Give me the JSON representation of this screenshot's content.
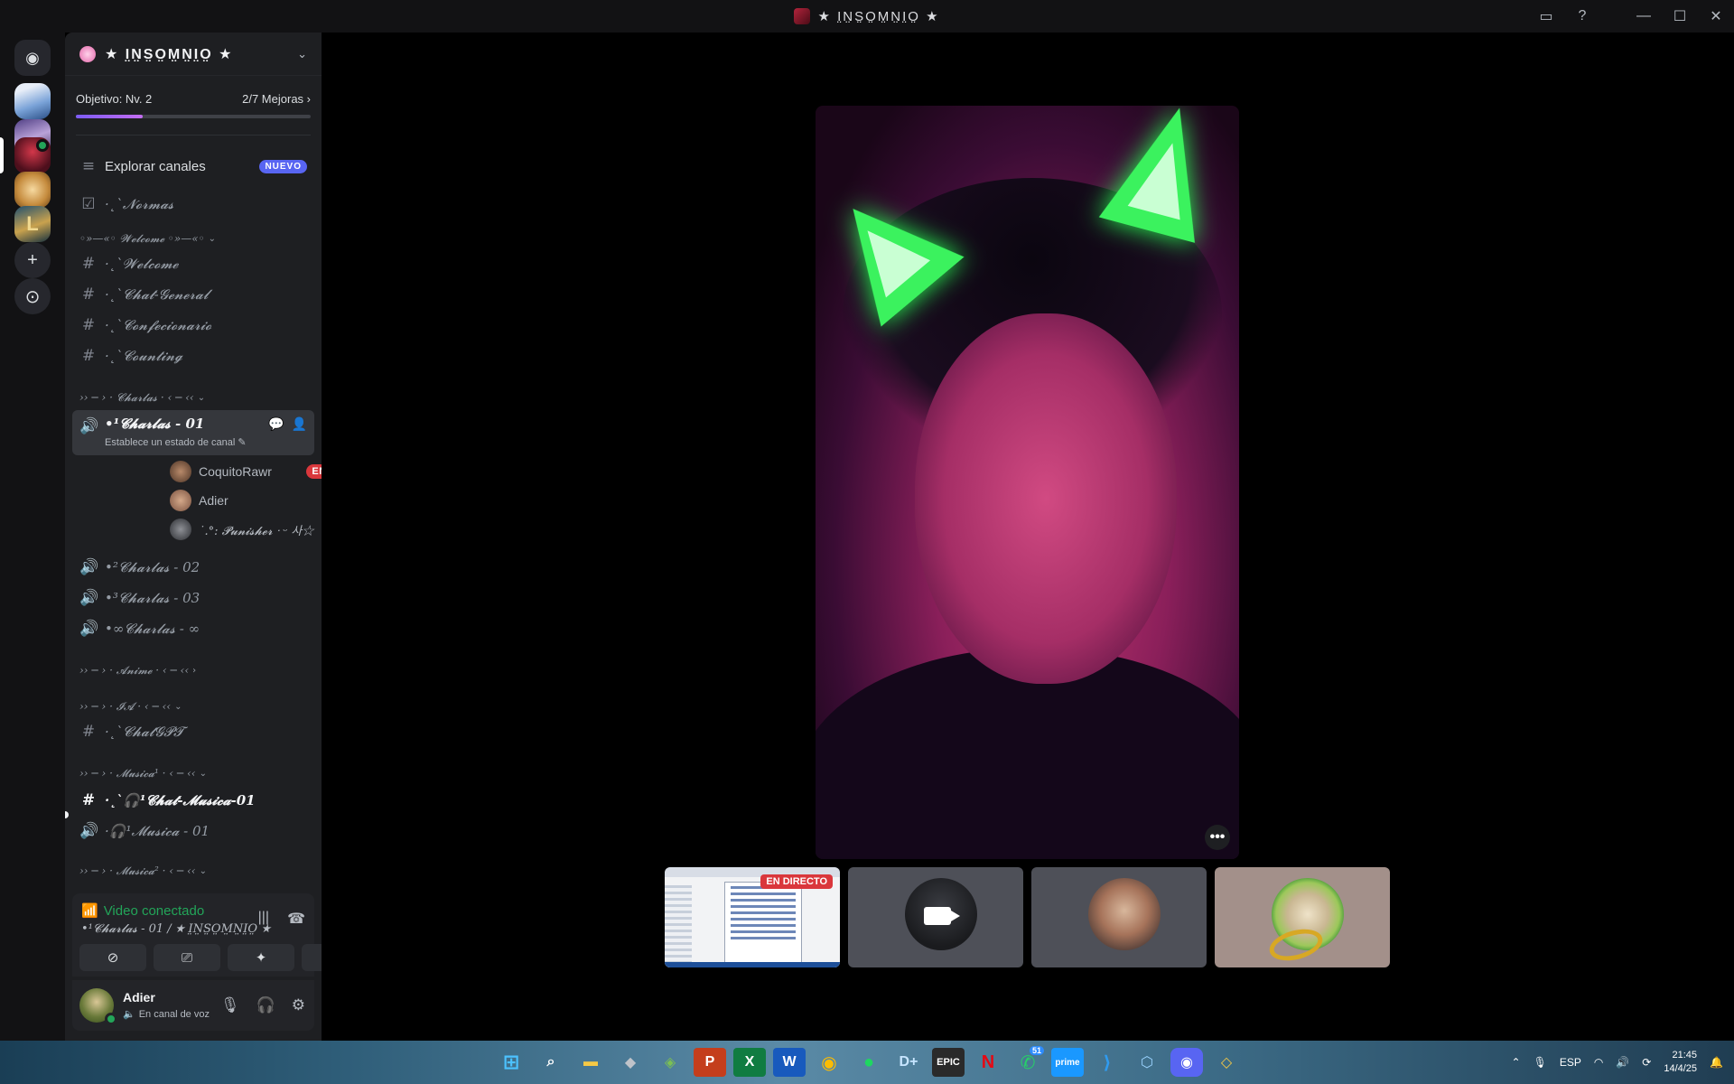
{
  "window": {
    "title": "★ I̤N̤S̤O̤M̤N̤I̤O̤ ★",
    "controls": [
      "inbox-icon",
      "help-icon",
      "minimize-icon",
      "maximize-icon",
      "close-icon"
    ]
  },
  "server_rail": {
    "home_icon": "discord-logo-icon",
    "servers": [
      "server-1",
      "server-2",
      "server-3",
      "server-4",
      "server-5"
    ],
    "server5_letter": "L",
    "add_icon": "+",
    "discover_icon": "⊙"
  },
  "guild": {
    "name": "★ I̤N̤S̤O̤M̤N̤I̤O̤ ★",
    "boost_goal": "Objetivo: Nv. 2",
    "boost_progress": "2/7 Mejoras",
    "boost_fraction": 0.286
  },
  "channels": {
    "explore_label": "Explorar canales",
    "explore_badge": "NUEVO",
    "rules": "·˛`𝓝𝓸𝓻𝓶𝓪𝓼",
    "cat_welcome": "◦»—«◦ 𝓦𝓮𝓵𝓬𝓸𝓶𝓮 ◦»—«◦",
    "welcome": "·˛`𝓦𝓮𝓵𝓬𝓸𝓶𝓮",
    "chat_general": "·˛`𝓒𝓱𝓪𝓽-𝓖𝓮𝓷𝓮𝓻𝓪𝓵",
    "confecionario": "·˛`𝓒𝓸𝓷𝓯𝓮𝓬𝓲𝓸𝓷𝓪𝓻𝓲𝓸",
    "counting": "·˛`𝓒𝓸𝓾𝓷𝓽𝓲𝓷𝓰",
    "cat_charlas": "›› ─ › · 𝓒𝓱𝓪𝓻𝓵𝓪𝓼 · ‹ ─ ‹‹",
    "charlas01": "•¹𝓒𝓱𝓪𝓻𝓵𝓪𝓼 - 01",
    "charlas01_status": "Establece un estado de canal",
    "voice_users": [
      {
        "name": "CoquitoRawr",
        "badge": "EN DIRECTO"
      },
      {
        "name": "Adier",
        "badge": ""
      },
      {
        "name": "˙.°: 𝓟𝓾𝓷𝓲𝓼𝓱𝓮𝓻 ᐧ ᵕ 사☆",
        "badge": ""
      }
    ],
    "charlas02": "•²𝓒𝓱𝓪𝓻𝓵𝓪𝓼 - 02",
    "charlas03": "•³𝓒𝓱𝓪𝓻𝓵𝓪𝓼 - 03",
    "charlas_inf": "•∞𝓒𝓱𝓪𝓻𝓵𝓪𝓼 - ∞",
    "cat_anime": "›› ─ › · 𝓐𝓷𝓲𝓶𝓮 · ‹ ─ ‹‹",
    "cat_ia": "›› ─ › · 𝓘𝓐 · ‹ ─ ‹‹",
    "chatgpt": "·˛`𝓒𝓱𝓪𝓽𝓖𝓟𝓣",
    "cat_musica": "›› ─ › · 𝓜𝓾𝓼𝓲𝓬𝓪¹ · ‹ ─ ‹‹",
    "chat_musica01": "·˛`🎧¹𝓒𝓱𝓪𝓽-𝓜𝓾𝓼𝓲𝓬𝓪-01",
    "musica01": "·🎧¹𝓜𝓾𝓼𝓲𝓬𝓪 - 01",
    "cat_musica2": "›› ─ › · 𝓜𝓾𝓼𝓲𝓬𝓪² · ‹ ─ ‹‹"
  },
  "voice_panel": {
    "status": "Video conectado",
    "channel": "•¹𝓒𝓱𝓪𝓻𝓵𝓪𝓼 - 01 / ★ I̤N̤S̤O̤M̤N̤I̤O̤ ★"
  },
  "user": {
    "name": "Adier",
    "status": "En canal de voz"
  },
  "stage": {
    "live_label": "EN DIRECTO",
    "more_label": "•••"
  },
  "taskbar": {
    "apps": [
      "windows-start-icon",
      "search-icon",
      "file-explorer-icon",
      "app-icon",
      "app-icon",
      "powerpoint-icon",
      "excel-icon",
      "word-icon",
      "chrome-icon",
      "spotify-icon",
      "disney-plus-icon",
      "epic-games-icon",
      "netflix-icon",
      "whatsapp-icon",
      "prime-video-icon",
      "vscode-icon",
      "app-icon",
      "discord-icon",
      "app-icon"
    ],
    "lang": "ESP",
    "time": "21:45",
    "date": "14/4/25",
    "whatsapp_badge": "51"
  },
  "colors": {
    "accent": "#5865f2",
    "online": "#23a559",
    "live": "#da373c"
  }
}
